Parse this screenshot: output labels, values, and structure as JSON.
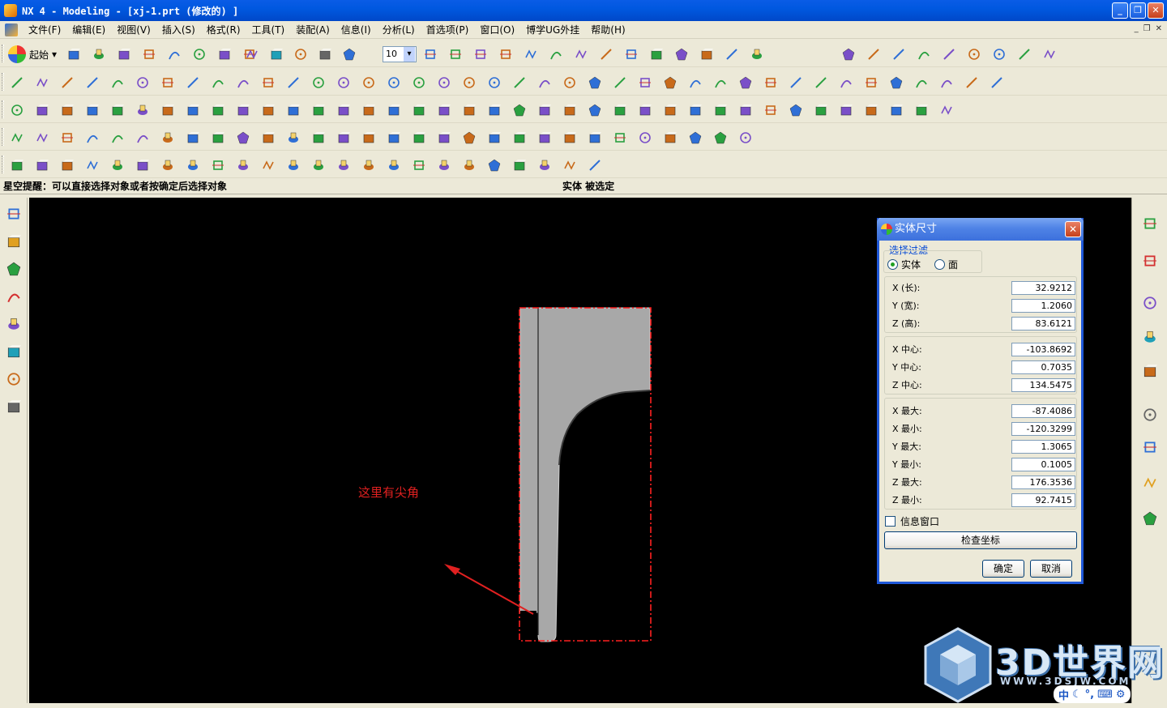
{
  "window": {
    "title": "NX 4 - Modeling - [xj-1.prt  (修改的) ]",
    "min_label": "_",
    "max_label": "❐",
    "close_label": "✕"
  },
  "menu": {
    "items": [
      "文件(F)",
      "编辑(E)",
      "视图(V)",
      "插入(S)",
      "格式(R)",
      "工具(T)",
      "装配(A)",
      "信息(I)",
      "分析(L)",
      "首选项(P)",
      "窗口(O)",
      "博学UG外挂",
      "帮助(H)"
    ],
    "mdi": [
      "_",
      "❐",
      "✕"
    ]
  },
  "toolbar": {
    "start_label": "起始",
    "layer_combo_value": "10"
  },
  "prompt": {
    "left": "星空提醒：可以直接选择对象或者按确定后选择对象",
    "right": "实体 被选定"
  },
  "canvas": {
    "annotation": "这里有尖角",
    "annotation_color": "#e02020",
    "bbox_color": "#ff2020",
    "part_color": "#a8a8a8"
  },
  "dialog": {
    "title": "实体尺寸",
    "filter_group_label": "选择过滤",
    "filter_options": [
      {
        "label": "实体",
        "selected": true
      },
      {
        "label": "面",
        "selected": false
      }
    ],
    "size_fields": [
      {
        "label": "X (长):",
        "value": "32.9212"
      },
      {
        "label": "Y (宽):",
        "value": "1.2060"
      },
      {
        "label": "Z (高):",
        "value": "83.6121"
      }
    ],
    "center_fields": [
      {
        "label": "X 中心:",
        "value": "-103.8692"
      },
      {
        "label": "Y 中心:",
        "value": "0.7035"
      },
      {
        "label": "Z 中心:",
        "value": "134.5475"
      }
    ],
    "range_fields": [
      {
        "label": "X 最大:",
        "value": "-87.4086"
      },
      {
        "label": "X 最小:",
        "value": "-120.3299"
      },
      {
        "label": "Y 最大:",
        "value": "1.3065"
      },
      {
        "label": "Y 最小:",
        "value": "0.1005"
      },
      {
        "label": "Z 最大:",
        "value": "176.3536"
      },
      {
        "label": "Z 最小:",
        "value": "92.7415"
      }
    ],
    "info_window_label": "信息窗口",
    "check_coords_label": "检查坐标",
    "ok_label": "确定",
    "cancel_label": "取消",
    "close_label": "✕"
  },
  "watermark": {
    "text": "3D世界网",
    "url": "WWW.3DSJW.COM"
  },
  "tray": {
    "ime_label": "中"
  }
}
